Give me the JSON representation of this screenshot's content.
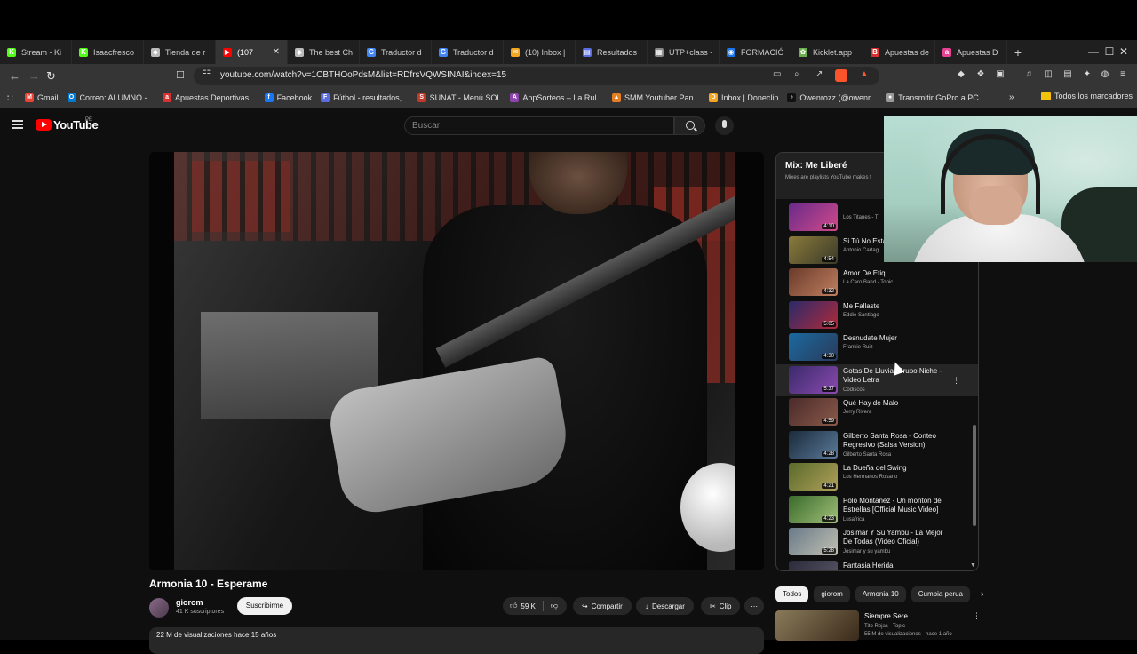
{
  "browser": {
    "tabs": [
      {
        "label": "Stream - Ki",
        "color": "#53fc18",
        "glyph": "K"
      },
      {
        "label": "Isaacfresco",
        "color": "#53fc18",
        "glyph": "K"
      },
      {
        "label": "Tienda de r",
        "color": "#bbbbbb",
        "glyph": "◆"
      },
      {
        "label": "(107",
        "color": "#ff0000",
        "glyph": "▶",
        "active": true
      },
      {
        "label": "The best Ch",
        "color": "#bbbbbb",
        "glyph": "◆"
      },
      {
        "label": "Traductor d",
        "color": "#4285f4",
        "glyph": "G"
      },
      {
        "label": "Traductor d",
        "color": "#4285f4",
        "glyph": "G"
      },
      {
        "label": "(10) Inbox |",
        "color": "#f5a623",
        "glyph": "✉"
      },
      {
        "label": "Resultados",
        "color": "#5b6ee1",
        "glyph": "▤"
      },
      {
        "label": "UTP+class -",
        "color": "#888888",
        "glyph": "▦"
      },
      {
        "label": "FORMACIÓ",
        "color": "#1a73e8",
        "glyph": "◉"
      },
      {
        "label": "Kicklet.app",
        "color": "#6ab04c",
        "glyph": "✿"
      },
      {
        "label": "Apuestas de",
        "color": "#d63031",
        "glyph": "B"
      },
      {
        "label": "Apuestas D",
        "color": "#e84393",
        "glyph": "a"
      }
    ],
    "new_tab": "+",
    "window_controls": {
      "minimize": "—",
      "maximize": "☐",
      "close": "✕"
    },
    "url": "youtube.com/watch?v=1CBTHOoPdsM&list=RDfrsVQWSINAI&index=15",
    "bookmarks": [
      {
        "label": "Gmail",
        "color": "#ea4335",
        "glyph": "M"
      },
      {
        "label": "Correo: ALUMNO -...",
        "color": "#0078d4",
        "glyph": "O"
      },
      {
        "label": "Apuestas Deportivas...",
        "color": "#d63031",
        "glyph": "a"
      },
      {
        "label": "Facebook",
        "color": "#1877f2",
        "glyph": "f"
      },
      {
        "label": "Fútbol - resultados,...",
        "color": "#5b6ee1",
        "glyph": "F"
      },
      {
        "label": "SUNAT - Menú SOL",
        "color": "#c0392b",
        "glyph": "S"
      },
      {
        "label": "AppSorteos – La Rul...",
        "color": "#8e44ad",
        "glyph": "A"
      },
      {
        "label": "SMM Youtuber Pan...",
        "color": "#e67e22",
        "glyph": "▲"
      },
      {
        "label": "Inbox | Doneclip",
        "color": "#f5a623",
        "glyph": "D"
      },
      {
        "label": "Owenrozz (@owenr...",
        "color": "#111111",
        "glyph": "♪"
      },
      {
        "label": "Transmitir GoPro a PC",
        "color": "#999999",
        "glyph": "●"
      }
    ],
    "all_bookmarks": "Todos los marcadores"
  },
  "youtube": {
    "logo_text": "YouTube",
    "country_code": "PE",
    "search_placeholder": "Buscar",
    "video": {
      "title": "Armonia 10 - Esperame",
      "channel": "giorom",
      "subscribers": "41 K suscriptores",
      "subscribe_label": "Suscribirme",
      "likes": "59 K",
      "share_label": "Compartir",
      "download_label": "Descargar",
      "clip_label": "Clip",
      "views_line": "22 M de visualizaciones  hace 15 años"
    },
    "playlist": {
      "title": "Mix: Me Liberé",
      "subtitle": "Mixes are playlists YouTube makes f",
      "items": [
        {
          "title": "",
          "artist": "Los Titanes - T",
          "duration": "4:10",
          "c1": "#6a2a8a",
          "c2": "#d04a8a"
        },
        {
          "title": "Si Tú No Esta",
          "artist": "Antonio Cartag",
          "duration": "4:54",
          "c1": "#8a7a3a",
          "c2": "#3a3a2a"
        },
        {
          "title": "Amor De Etiq",
          "artist": "La Caro Band - Topic",
          "duration": "4:32",
          "c1": "#6a3a2a",
          "c2": "#c08060"
        },
        {
          "title": "Me Fallaste",
          "artist": "Eddie Santiago",
          "duration": "5:05",
          "c1": "#2a2a6a",
          "c2": "#b02a3a"
        },
        {
          "title": "Desnudate Mujer",
          "artist": "Frankie Ruiz",
          "duration": "4:30",
          "c1": "#1a6aa0",
          "c2": "#2a3a5a"
        },
        {
          "title": "Gotas De Lluvia, Grupo Niche - Video Letra",
          "artist": "Codiscos",
          "duration": "5:37",
          "c1": "#3a2a6a",
          "c2": "#8a4ab0",
          "hover": true
        },
        {
          "title": "Qué Hay de Malo",
          "artist": "Jerry Rivera",
          "duration": "4:59",
          "c1": "#4a2a2a",
          "c2": "#8a5a4a"
        },
        {
          "title": "Gilberto Santa Rosa - Conteo Regresivo (Salsa Version)",
          "artist": "Gilberto Santa Rosa",
          "duration": "4:28",
          "c1": "#1a2a3a",
          "c2": "#5a7a9a"
        },
        {
          "title": "La Dueña del Swing",
          "artist": "Los Hermanos Rosario",
          "duration": "4:21",
          "c1": "#5a6a2a",
          "c2": "#b0a05a"
        },
        {
          "title": "Polo Montanez - Un monton de Estrellas [Official Music Video]",
          "artist": "Lusafrica",
          "duration": "4:23",
          "c1": "#3a6a2a",
          "c2": "#a0c07a"
        },
        {
          "title": "Josimar Y Su Yambú - La Mejor De Todas (Video Oficial)",
          "artist": "Josimar y su yambu",
          "duration": "5:28",
          "c1": "#6a7a8a",
          "c2": "#c0c0b0"
        },
        {
          "title": "Fantasia Herida",
          "artist": "",
          "duration": "",
          "c1": "#2a2a3a",
          "c2": "#5a5a6a"
        }
      ]
    },
    "chips": [
      {
        "label": "Todos",
        "selected": true
      },
      {
        "label": "giorom"
      },
      {
        "label": "Armonia 10"
      },
      {
        "label": "Cumbia perua"
      }
    ],
    "recommended": {
      "title": "Siempre Sere",
      "artist": "Tito Rojas - Topic",
      "meta": "55 M de visualizaciones · hace 1 año"
    }
  }
}
